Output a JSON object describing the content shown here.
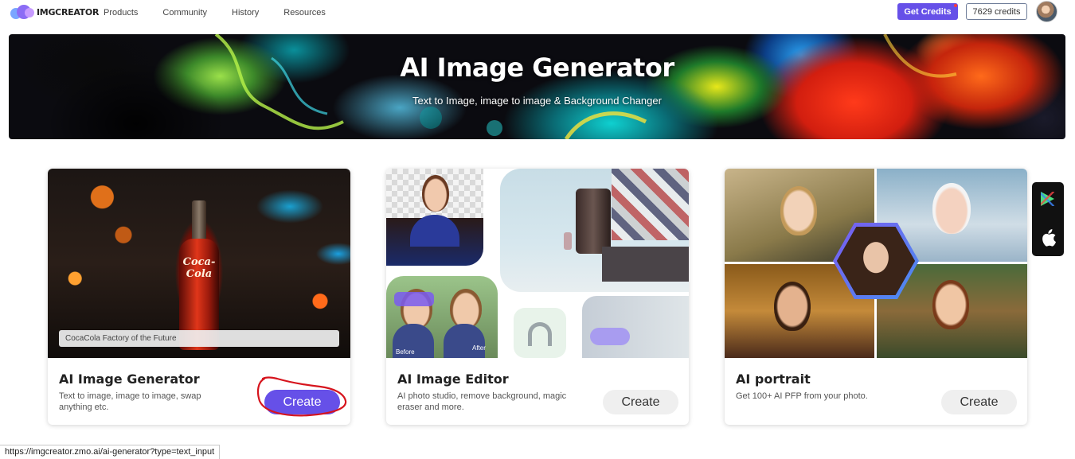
{
  "nav": {
    "brand": "IMGCREATOR",
    "links": [
      "Products",
      "Community",
      "History",
      "Resources"
    ],
    "get_credits": "Get Credits",
    "credits": "7629 credits"
  },
  "hero": {
    "title": "AI Image Generator",
    "subtitle": "Text to Image, image to image & Background Changer"
  },
  "cards": [
    {
      "title": "AI Image Generator",
      "description": "Text to image, image to image, swap anything etc.",
      "button": "Create",
      "image_caption": "CocaCola Factory of the Future",
      "image_label": "Coca-Cola"
    },
    {
      "title": "AI Image Editor",
      "description": "AI photo studio, remove background, magic eraser and more.",
      "button": "Create",
      "before_label": "Before",
      "after_label": "After"
    },
    {
      "title": "AI portrait",
      "description": "Get 100+ AI PFP from your photo.",
      "button": "Create"
    }
  ],
  "status_bar": {
    "url": "https://imgcreator.zmo.ai/ai-generator?type=text_input"
  },
  "colors": {
    "accent": "#6650e8",
    "annotation": "#d6141d"
  },
  "icons": {
    "store_google": "google-play-icon",
    "store_apple": "apple-icon"
  }
}
